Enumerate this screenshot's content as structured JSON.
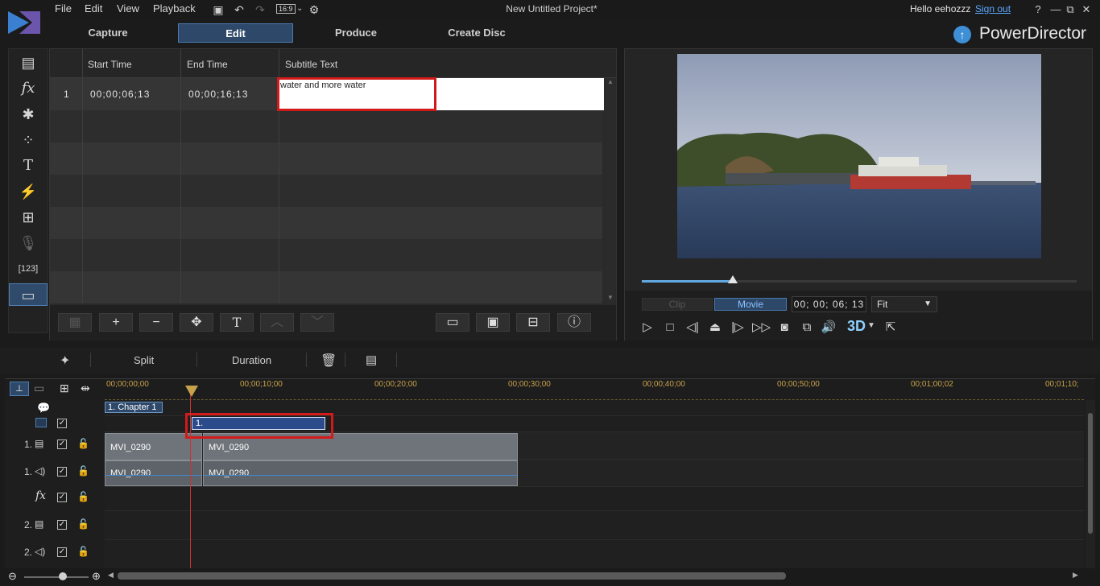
{
  "app": {
    "menus": [
      "File",
      "Edit",
      "View",
      "Playback"
    ],
    "aspect_ratio": "16:9",
    "project_title": "New Untitled Project*",
    "greeting": "Hello eehozzz",
    "sign_out": "Sign out",
    "brand": "PowerDirector",
    "window_buttons": [
      "?",
      "—",
      "⧉",
      "✕"
    ]
  },
  "mode_tabs": [
    "Capture",
    "Edit",
    "Produce",
    "Create Disc"
  ],
  "rooms": [
    "media-room-icon",
    "fx-room-icon",
    "pip-room-icon",
    "particle-room-icon",
    "title-room-icon",
    "transition-room-icon",
    "audio-mixing-room-icon",
    "voice-over-room-icon",
    "chapter-room-icon",
    "subtitle-room-icon"
  ],
  "subtitle_room": {
    "columns": [
      "Start Time",
      "End Time",
      "Subtitle Text"
    ],
    "rows": [
      {
        "index": "1",
        "start": "00;00;06;13",
        "end": "00;00;16;13",
        "text": "water and more water"
      }
    ]
  },
  "preview": {
    "clip_label": "Clip",
    "movie_label": "Movie",
    "timecode": "00; 00; 06; 13",
    "fit": "Fit",
    "mode_3d": "3D",
    "progress": 0.21
  },
  "timeline_toolbar": {
    "split": "Split",
    "duration": "Duration"
  },
  "ruler_ticks": [
    "00;00;00;00",
    "00;00;10;00",
    "00;00;20;00",
    "00;00;30;00",
    "00;00;40;00",
    "00;00;50;00",
    "00;01;00;02",
    "00;01;10;"
  ],
  "timeline": {
    "chapter_label": "1. Chapter 1",
    "subtitle_clip_label": "1.",
    "tracks": [
      {
        "num": "1.",
        "type": "video"
      },
      {
        "num": "1.",
        "type": "audio"
      },
      {
        "num": "",
        "type": "fx"
      },
      {
        "num": "2.",
        "type": "video"
      },
      {
        "num": "2.",
        "type": "audio"
      }
    ],
    "clip_name": "MVI_0290"
  },
  "colors": {
    "accent": "#3e8fd6",
    "highlight": "#d21a1a",
    "active_tab": "#2d4869"
  }
}
